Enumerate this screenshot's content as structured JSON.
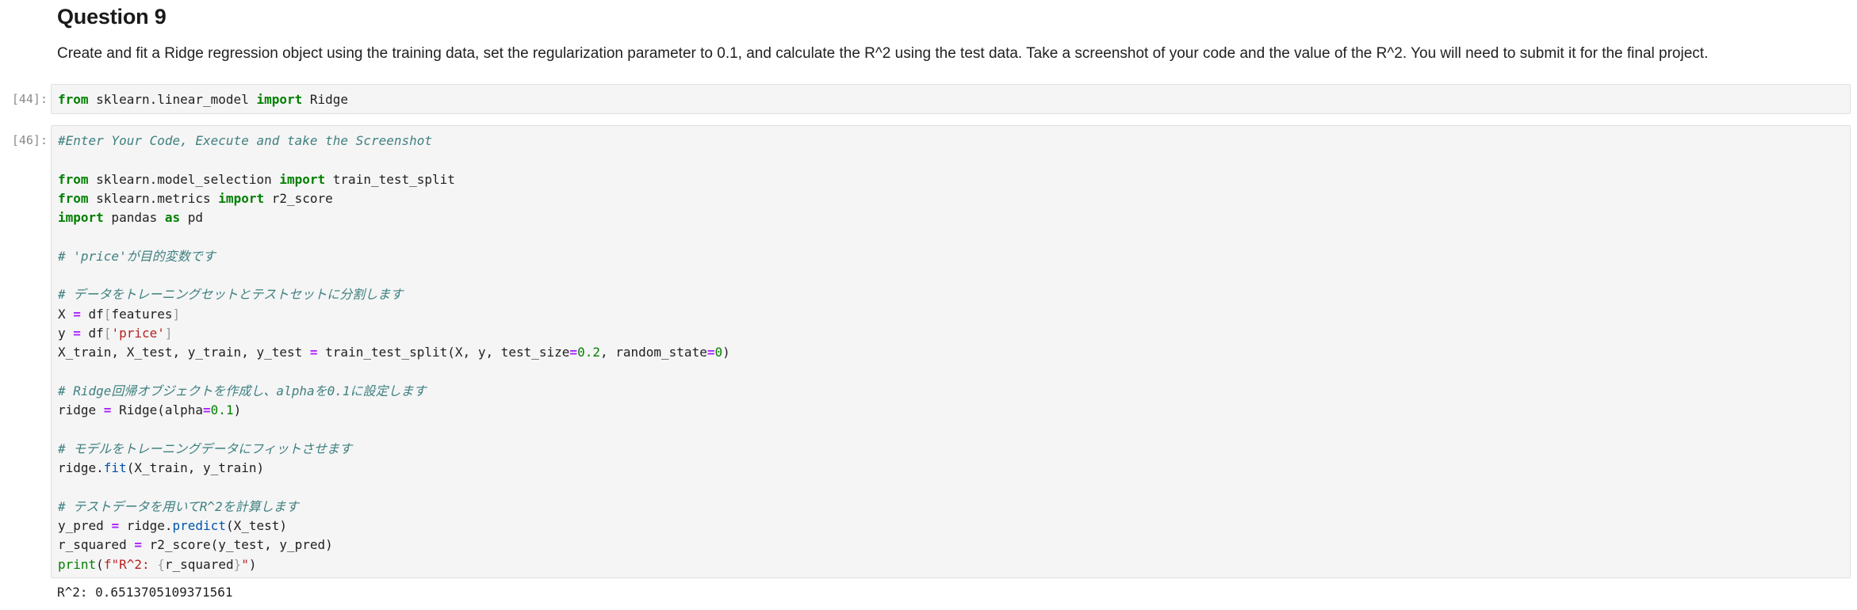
{
  "markdown": {
    "title": "Question 9",
    "description": "Create and fit a Ridge regression object using the training data, set the regularization parameter to 0.1, and calculate the R^2 using the test data. Take a screenshot of your code and the value of the R^2. You will need to submit it for the final project."
  },
  "cell1": {
    "prompt": "[44]:",
    "code": {
      "kw1": "from",
      "mod": " sklearn.linear_model ",
      "kw2": "import",
      "name": " Ridge"
    }
  },
  "cell2": {
    "prompt": "[46]:",
    "lines": {
      "c1": "#Enter Your Code, Execute and take the Screenshot",
      "l3_kw1": "from",
      "l3_mod": " sklearn.model_selection ",
      "l3_kw2": "import",
      "l3_name": " train_test_split",
      "l4_kw1": "from",
      "l4_mod": " sklearn.metrics ",
      "l4_kw2": "import",
      "l4_name": " r2_score",
      "l5_kw1": "import",
      "l5_mod": " pandas ",
      "l5_kw2": "as",
      "l5_name": " pd",
      "c2": "# 'price'が目的変数です",
      "c3": "# データをトレーニングセットとテストセットに分割します",
      "l9_a": "X ",
      "l9_op": "=",
      "l9_b": " df",
      "l9_br1": "[",
      "l9_c": "features",
      "l9_br2": "]",
      "l10_a": "y ",
      "l10_op": "=",
      "l10_b": " df",
      "l10_br1": "[",
      "l10_str": "'price'",
      "l10_br2": "]",
      "l11_a": "X_train, X_test, y_train, y_test ",
      "l11_op": "=",
      "l11_b": " train_test_split(X, y, test_size",
      "l11_op2": "=",
      "l11_n1": "0.2",
      "l11_c": ", random_state",
      "l11_op3": "=",
      "l11_n2": "0",
      "l11_d": ")",
      "c4": "# Ridge回帰オブジェクトを作成し、alphaを0.1に設定します",
      "l14_a": "ridge ",
      "l14_op": "=",
      "l14_b": " Ridge(alpha",
      "l14_op2": "=",
      "l14_n": "0.1",
      "l14_c": ")",
      "c5": "# モデルをトレーニングデータにフィットさせます",
      "l17_a": "ridge.",
      "l17_fn": "fit",
      "l17_b": "(X_train, y_train)",
      "c6": "# テストデータを用いてR^2を計算します",
      "l20_a": "y_pred ",
      "l20_op": "=",
      "l20_b": " ridge.",
      "l20_fn": "predict",
      "l20_c": "(X_test)",
      "l21_a": "r_squared ",
      "l21_op": "=",
      "l21_b": " r2_score(y_test, y_pred)",
      "l22_fn": "print",
      "l22_a": "(",
      "l22_str1": "f\"R^2: ",
      "l22_br1": "{",
      "l22_b": "r_squared",
      "l22_br2": "}",
      "l22_str2": "\"",
      "l22_c": ")"
    },
    "output": "R^2: 0.6513705109371561"
  }
}
